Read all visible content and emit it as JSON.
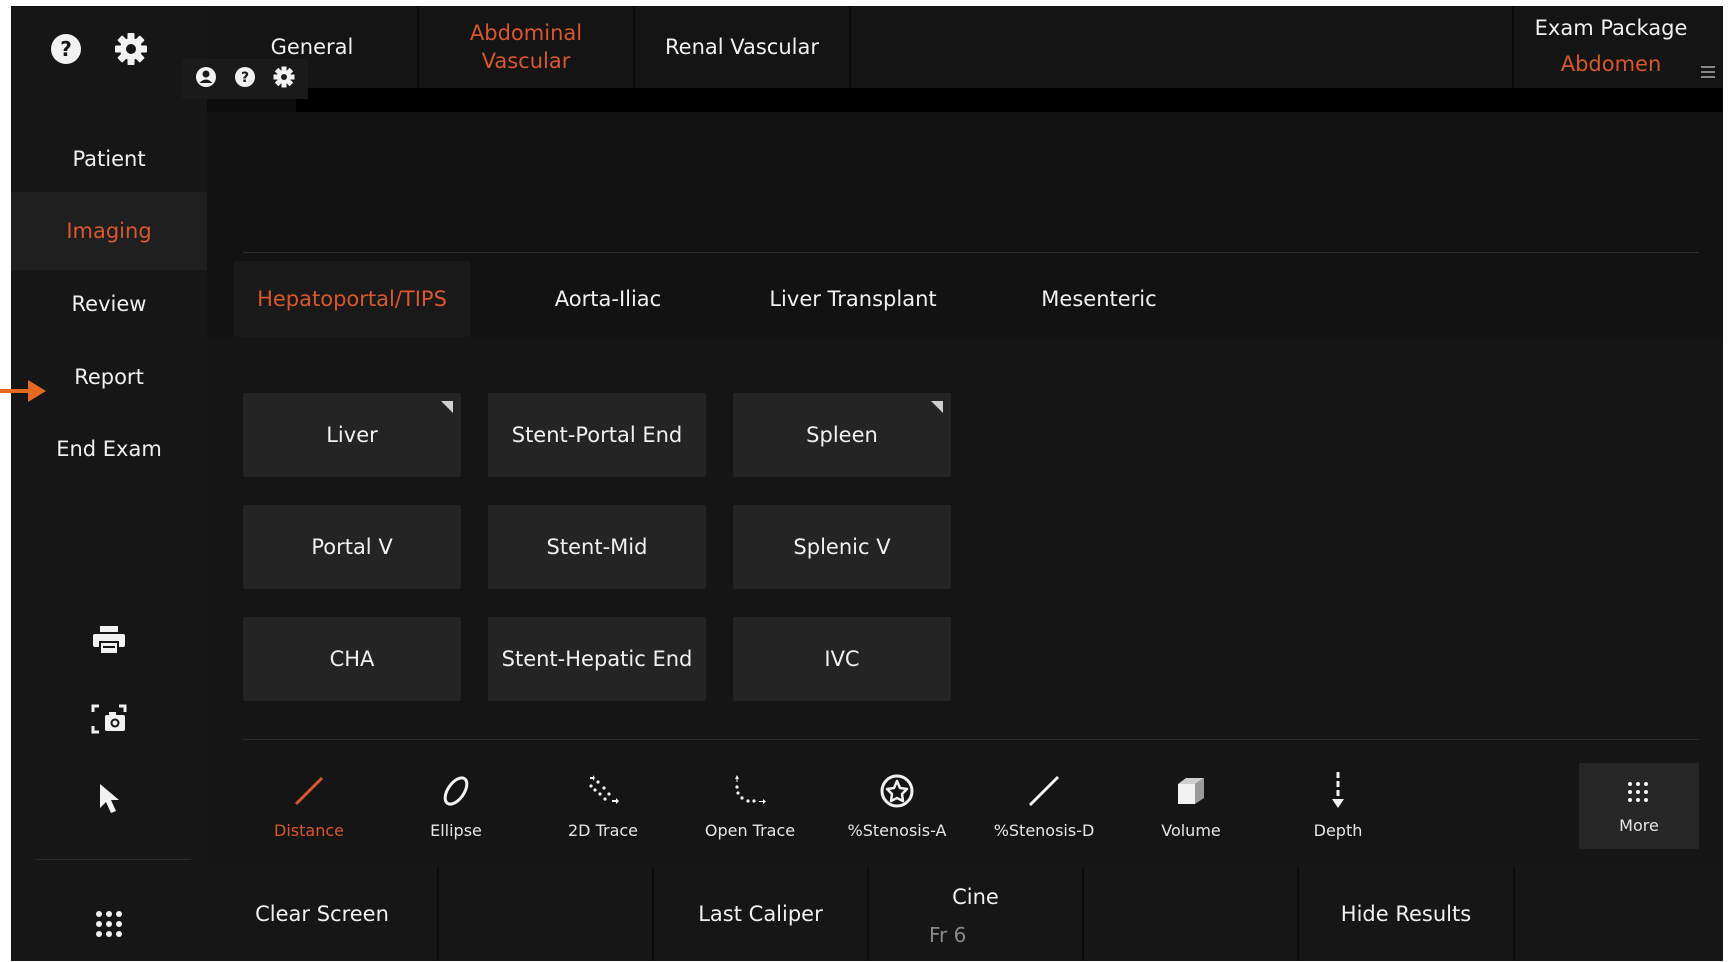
{
  "sidebar": {
    "items": [
      {
        "label": "Patient"
      },
      {
        "label": "Imaging"
      },
      {
        "label": "Review"
      },
      {
        "label": "Report"
      },
      {
        "label": "End Exam"
      }
    ],
    "icons": [
      "help-icon",
      "gear-icon",
      "printer-icon",
      "screenshot-icon",
      "cursor-icon",
      "apps-grid-icon"
    ]
  },
  "mini_toolbar": [
    "user-icon",
    "help-icon",
    "gear-icon"
  ],
  "top_tabs": [
    {
      "label": "General"
    },
    {
      "label": "Abdominal Vascular"
    },
    {
      "label": "Renal Vascular"
    }
  ],
  "exam_package": {
    "title": "Exam Package",
    "value": "Abdomen"
  },
  "sub_tabs": [
    {
      "label": "Hepatoportal/TIPS"
    },
    {
      "label": "Aorta-Iliac"
    },
    {
      "label": "Liver Transplant"
    },
    {
      "label": "Mesenteric"
    }
  ],
  "measurement_buttons": [
    {
      "label": "Liver",
      "has_submenu": true
    },
    {
      "label": "Stent-Portal End",
      "has_submenu": false
    },
    {
      "label": "Spleen",
      "has_submenu": true
    },
    {
      "label": "Portal V",
      "has_submenu": false
    },
    {
      "label": "Stent-Mid",
      "has_submenu": false
    },
    {
      "label": "Splenic V",
      "has_submenu": false
    },
    {
      "label": "CHA",
      "has_submenu": false
    },
    {
      "label": "Stent-Hepatic End",
      "has_submenu": false
    },
    {
      "label": "IVC",
      "has_submenu": false
    }
  ],
  "tools": [
    {
      "label": "Distance",
      "icon": "distance-icon"
    },
    {
      "label": "Ellipse",
      "icon": "ellipse-icon"
    },
    {
      "label": "2D Trace",
      "icon": "trace-icon"
    },
    {
      "label": "Open Trace",
      "icon": "open-trace-icon"
    },
    {
      "label": "%Stenosis-A",
      "icon": "stenosis-area-icon"
    },
    {
      "label": "%Stenosis-D",
      "icon": "stenosis-diameter-icon"
    },
    {
      "label": "Volume",
      "icon": "cube-icon"
    },
    {
      "label": "Depth",
      "icon": "depth-icon"
    },
    {
      "label": "More",
      "icon": "grid-icon"
    }
  ],
  "bottom_bar": {
    "clear_screen": "Clear Screen",
    "last_caliper": "Last Caliper",
    "cine_label": "Cine",
    "cine_value": "Fr 6",
    "hide_results": "Hide Results"
  },
  "colors": {
    "accent": "#d9572b",
    "background": "#0d0d0d",
    "button": "#242424"
  }
}
